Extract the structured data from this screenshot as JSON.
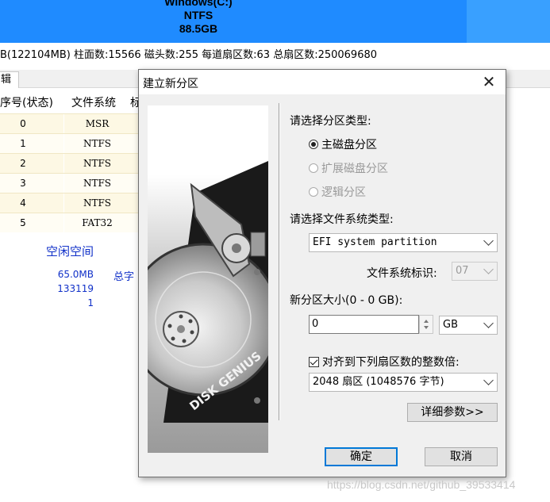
{
  "background": {
    "disk_partition": {
      "name": "Windows(C:)",
      "fs": "NTFS",
      "size": "88.5GB"
    },
    "disk_info": "B(122104MB)  柱面数:15566  磁头数:255  每道扇区数:63  总扇区数:250069680",
    "tab_label": "辑",
    "table": {
      "headers": [
        "序号(状态)",
        "文件系统",
        "标"
      ],
      "rows": [
        {
          "index": "0",
          "fs": "MSR"
        },
        {
          "index": "1",
          "fs": "NTFS"
        },
        {
          "index": "2",
          "fs": "NTFS"
        },
        {
          "index": "3",
          "fs": "NTFS"
        },
        {
          "index": "4",
          "fs": "NTFS"
        },
        {
          "index": "5",
          "fs": "FAT32"
        }
      ]
    },
    "free_space_label": "空闲空间",
    "free_space_size": "65.0MB",
    "free_space_sectors": "133119",
    "free_space_third": "1",
    "free_space_side": "总字",
    "watermark": "https://blog.csdn.net/github_39533414"
  },
  "dialog": {
    "title": "建立新分区",
    "close_glyph": "✕",
    "partition_type_label": "请选择分区类型:",
    "radio_primary": "主磁盘分区",
    "radio_extended": "扩展磁盘分区",
    "radio_logical": "逻辑分区",
    "fs_type_label": "请选择文件系统类型:",
    "fs_type_value": "EFI system partition",
    "fs_id_label": "文件系统标识:",
    "fs_id_value": "07",
    "size_label": "新分区大小(0 - 0 GB):",
    "size_value": "0",
    "size_unit": "GB",
    "align_label": "对齐到下列扇区数的整数倍:",
    "align_value": "2048 扇区 (1048576 字节)",
    "details_button": "详细参数>>",
    "ok_button": "确定",
    "cancel_button": "取消",
    "art_logo": "DISK GENIUS"
  }
}
